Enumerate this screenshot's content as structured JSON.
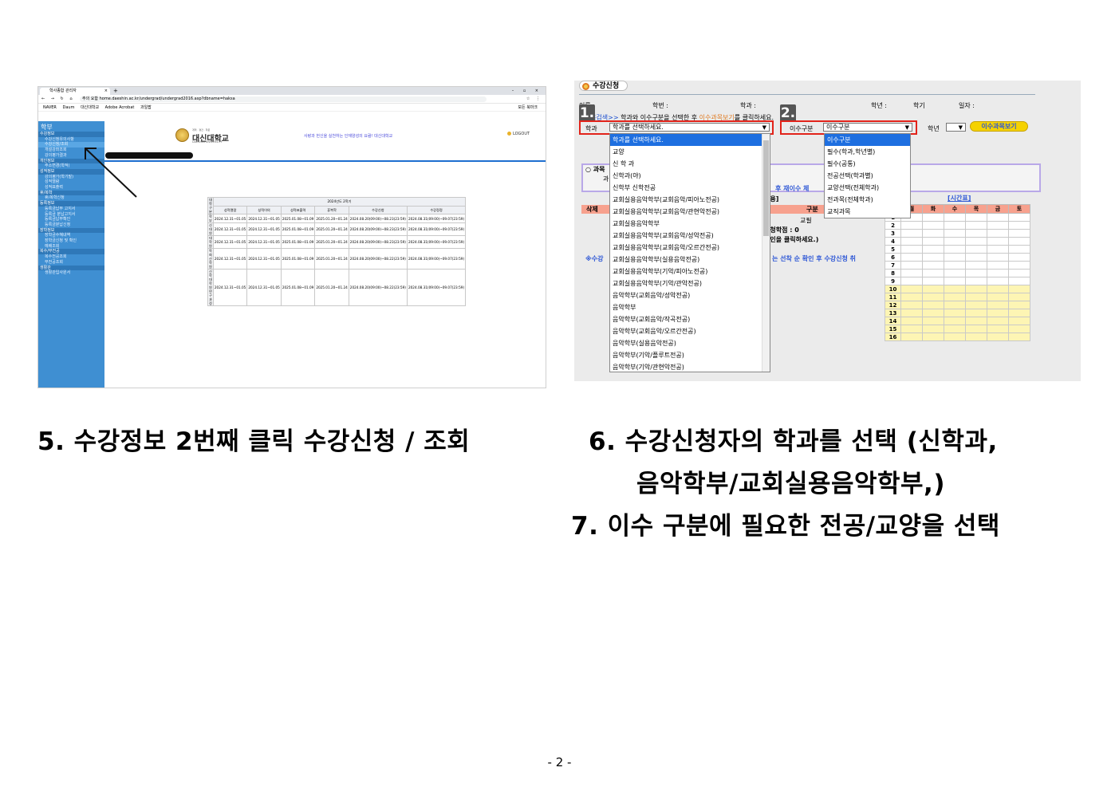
{
  "browser": {
    "tab_title": "학사종합 관리자",
    "url_prefix": "주의 요함",
    "url": "home.daeshin.ac.kr/undergrad/undergrad2016.asp?dbname=haksa",
    "bookmarks": [
      "NAVER",
      "Daum",
      "대신대학교",
      "Adobe Acrobat",
      "과일팝"
    ],
    "bookmarks_all": "모든 북마크"
  },
  "sidebar": {
    "title": "학부",
    "items": [
      {
        "label": "수강정보",
        "type": "section"
      },
      {
        "label": "수강신청유의사항",
        "type": "item"
      },
      {
        "label": "수강신청/조회",
        "type": "highlight"
      },
      {
        "label": "개설강좌조회",
        "type": "item"
      },
      {
        "label": "강의평가결과",
        "type": "item"
      },
      {
        "label": "개인정보",
        "type": "section"
      },
      {
        "label": "주소변경(학적)",
        "type": "item"
      },
      {
        "label": "성적정보",
        "type": "section"
      },
      {
        "label": "강의평가(학기말)",
        "type": "item"
      },
      {
        "label": "성적열람",
        "type": "item"
      },
      {
        "label": "성적표출력",
        "type": "item"
      },
      {
        "label": "휴/복학",
        "type": "section"
      },
      {
        "label": "휴/복학신청",
        "type": "item"
      },
      {
        "label": "등록정보",
        "type": "section"
      },
      {
        "label": "등록금납부 고지서",
        "type": "item"
      },
      {
        "label": "등록금 분납고지서",
        "type": "item"
      },
      {
        "label": "등록금납부확인",
        "type": "item"
      },
      {
        "label": "등록금분납신청",
        "type": "item"
      },
      {
        "label": "장학정보",
        "type": "section"
      },
      {
        "label": "장학금수혜내역",
        "type": "item"
      },
      {
        "label": "장학금신청 및 확인",
        "type": "item"
      },
      {
        "label": "예배조회",
        "type": "item"
      },
      {
        "label": "복수/부전공",
        "type": "section"
      },
      {
        "label": "복수전공조회",
        "type": "item"
      },
      {
        "label": "부전공조회",
        "type": "item"
      },
      {
        "label": "생활관",
        "type": "section"
      },
      {
        "label": "생활관입사원서",
        "type": "item"
      }
    ]
  },
  "portal": {
    "logo_small": "개혁 · 경건 · 학문",
    "logo_name": "대신대학교",
    "logo_en": "DAESHIN UNIVERSITY",
    "slogan": "사랑과 헌신을 실천하는 인재양성의 요람! 대신대학교",
    "logout": "LOGOUT"
  },
  "grades_table": {
    "term": "2024년도 2학기",
    "cat_header": "대학구분",
    "columns": [
      "성적열람",
      "성적이의",
      "성적표출력",
      "휴복학",
      "수강신청",
      "수강정정"
    ],
    "rows": [
      {
        "cat": "학 부",
        "cells": [
          "2024.12.31~01.05",
          "2024.12.31~01.05",
          "2025.01.08~01.09",
          "2025.01.20~01.24",
          "2024.08.20(09:00)~08.23(23:59)",
          "2024.08.31(09:00)~09.07(23:59)"
        ]
      },
      {
        "cat": "신대원",
        "cells": [
          "2024.12.31~01.05",
          "2024.12.31~01.05",
          "2025.01.08~01.09",
          "2025.01.20~01.24",
          "2024.08.20(09:00)~08.23(23:59)",
          "2024.08.31(09:00)~09.07(23:59)"
        ]
      },
      {
        "cat": "대학원",
        "cells": [
          "2024.12.31~01.05",
          "2024.12.31~01.05",
          "2025.01.08~01.09",
          "2025.01.20~01.24",
          "2024.08.20(09:00)~08.23(23:59)",
          "2024.08.31(09:00)~09.07(23:59)"
        ]
      },
      {
        "cat": "목회신학원",
        "cells": [
          "2024.12.31~01.05",
          "2024.12.31~01.05",
          "2025.01.08~01.09",
          "2025.01.20~01.24",
          "2024.08.20(09:00)~08.22(23:59)",
          "2024.08.31(09:00)~09.07(23:59)"
        ]
      },
      {
        "cat": "신학대학원 연구과정",
        "cells": [
          "2024.12.31~01.05",
          "2024.12.31~01.05",
          "2025.01.08~01.09",
          "2025.01.20~01.24",
          "2024.08.20(09:00)~08.22(23:59)",
          "2024.08.31(09:00)~09.07(23:59)"
        ]
      }
    ]
  },
  "registration": {
    "header": "수강신청",
    "info": {
      "name": "이름 :",
      "student_no": "학번 :",
      "dept": "학과 :",
      "year": "학년 :",
      "semester": "학기",
      "date": "일자 :"
    },
    "guide_prefix": "※과목검색>>",
    "guide_mid": "학과와 이수구분을 선택한 후",
    "guide_link": "이수과목보기",
    "guide_suffix": "를 클릭하세요.",
    "badge1": "1.",
    "badge2": "2.",
    "dept_label": "학과",
    "dept_selected": "학과를 선택하세요.",
    "dept_options": [
      "학과를 선택하세요.",
      "교양",
      "신 학 과",
      "신학과(야)",
      "신학부 신학전공",
      "교회실용음악학부(교회음악/피아노전공)",
      "교회실용음악학부(교회음악/관현악전공)",
      "교회실용음악학부",
      "교회실용음악학부(교회음악/성악전공)",
      "교회실용음악학부(교회음악/오르간전공)",
      "교회실용음악학부(실용음악전공)",
      "교회실용음악학부(기악/피아노전공)",
      "교회실용음악학부(기악/관악전공)",
      "음악학부(교회음악/성악전공)",
      "음악학부",
      "음악학부(교회음악/작곡전공)",
      "음악학부(교회음악/오르간전공)",
      "음악학부(실용음악전공)",
      "음악학부(기악/플루트전공)",
      "음악학부(기악/관현악전공)"
    ],
    "type_label": "이수구분",
    "type_selected": "이수구분",
    "type_options": [
      "이수구분",
      "필수(학과,학년별)",
      "필수(공통)",
      "전공선택(학과별)",
      "교양선택(전체학과)",
      "전과목(전체학과)",
      "교직과목"
    ],
    "grade_label": "학년",
    "view_button": "이수과목보기",
    "bg_course": "○ 과목",
    "bg_course_sub": "과",
    "bg_retake": "후 재이수 체",
    "bg_content": "내용]",
    "bg_delete": "삭제",
    "bg_gubun": "구분",
    "bg_gyopil": "교필",
    "bg_credit": "신청학점 : 0",
    "bg_click": "확인을 클릭하세요.)",
    "bg_note_left": "※수강",
    "bg_note_right": "는 선착 순 확인 후 수강신청 취",
    "timetable_title": "[시간표]",
    "days": [
      "월",
      "화",
      "수",
      "목",
      "금",
      "토"
    ],
    "periods": [
      "1",
      "2",
      "3",
      "4",
      "5",
      "6",
      "7",
      "8",
      "9",
      "10",
      "11",
      "12",
      "13",
      "14",
      "15",
      "16"
    ]
  },
  "captions": {
    "step5": "5. 수강정보 2번째 클릭 수강신청 / 조회",
    "step6_line1": "6. 수강신청자의 학과를 선택 (신학과,",
    "step6_line2": "음악학부/교회실용음악학부,)",
    "step7": "7. 이수 구분에 필요한 전공/교양을 선택"
  },
  "page_number": "- 2 -"
}
